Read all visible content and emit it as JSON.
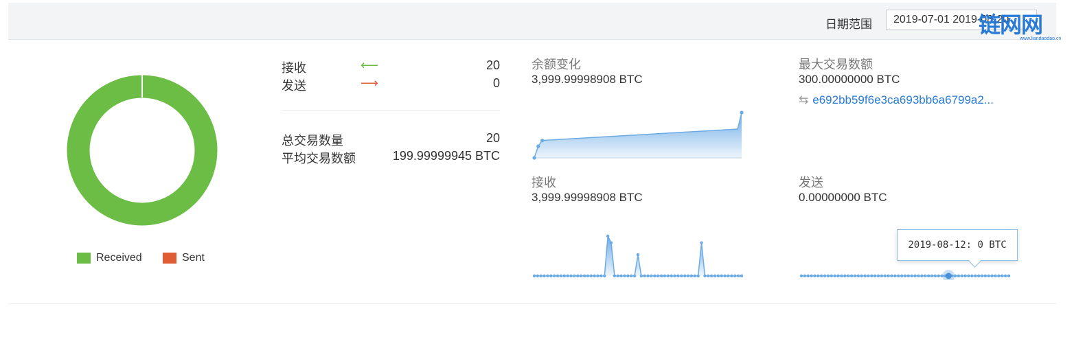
{
  "filter": {
    "date_label": "日期范围",
    "date_range": "2019-07-01  2019-08-20"
  },
  "watermark": {
    "text": "链网网",
    "sub": "www.liandaodao.cn"
  },
  "legend": {
    "received": "Received",
    "sent": "Sent"
  },
  "colors": {
    "received": "#6bbd45",
    "sent": "#e05c34",
    "accent": "#2a7bd6",
    "spark": "#6aaae5"
  },
  "summary": {
    "received_label": "接收",
    "received_count": "20",
    "sent_label": "发送",
    "sent_count": "0",
    "total_label": "总交易数量",
    "total_value": "20",
    "avg_label": "平均交易数额",
    "avg_value": "199.99999945 BTC"
  },
  "cards": {
    "balance_change": {
      "title": "余额变化",
      "value": "3,999.99998908 BTC"
    },
    "max_tx": {
      "title": "最大交易数额",
      "value": "300.00000000 BTC",
      "tx_hash": "e692bb59f6e3ca693bb6a6799a2..."
    },
    "received": {
      "title": "接收",
      "value": "3,999.99998908 BTC"
    },
    "sent": {
      "title": "发送",
      "value": "0.00000000 BTC"
    }
  },
  "tooltip": {
    "text": "2019-08-12: 0 BTC"
  },
  "chart_data": [
    {
      "type": "pie",
      "series": [
        {
          "name": "Received",
          "value": 20
        },
        {
          "name": "Sent",
          "value": 0
        }
      ]
    },
    {
      "type": "area",
      "name": "余额变化",
      "y": [
        0,
        1000,
        1500,
        1520,
        1540,
        1560,
        1580,
        1600,
        1620,
        1640,
        1660,
        1680,
        1700,
        1720,
        1740,
        1760,
        1780,
        1800,
        1820,
        1840,
        1860,
        1880,
        1900,
        1920,
        1940,
        1960,
        1980,
        2000,
        2020,
        2040,
        2060,
        2080,
        2100,
        2120,
        2140,
        2160,
        2180,
        2200,
        2220,
        2240,
        2260,
        2280,
        2300,
        2320,
        2340,
        2360,
        2380,
        2400,
        2420,
        2440,
        2460,
        2480,
        3900
      ]
    },
    {
      "type": "area",
      "name": "接收",
      "y": [
        0,
        0,
        0,
        0,
        0,
        0,
        0,
        0,
        0,
        0,
        0,
        0,
        0,
        0,
        0,
        0,
        0,
        0,
        0,
        0,
        0,
        0,
        300,
        250,
        0,
        0,
        0,
        0,
        0,
        0,
        0,
        160,
        0,
        0,
        0,
        0,
        0,
        0,
        0,
        0,
        0,
        0,
        0,
        0,
        0,
        0,
        0,
        0,
        0,
        0,
        250,
        0,
        0,
        0,
        0,
        0,
        0,
        0,
        0,
        0,
        0,
        0,
        0
      ]
    },
    {
      "type": "area",
      "name": "发送",
      "y": [
        0,
        0,
        0,
        0,
        0,
        0,
        0,
        0,
        0,
        0,
        0,
        0,
        0,
        0,
        0,
        0,
        0,
        0,
        0,
        0,
        0,
        0,
        0,
        0,
        0,
        0,
        0,
        0,
        0,
        0,
        0,
        0,
        0,
        0,
        0,
        0,
        0,
        0,
        0,
        0,
        0,
        0,
        0,
        0,
        0,
        0,
        0,
        0,
        0,
        0,
        0,
        0,
        0,
        0,
        0,
        0,
        0,
        0,
        0,
        0,
        0,
        0,
        0
      ],
      "highlight_index": 44
    }
  ]
}
